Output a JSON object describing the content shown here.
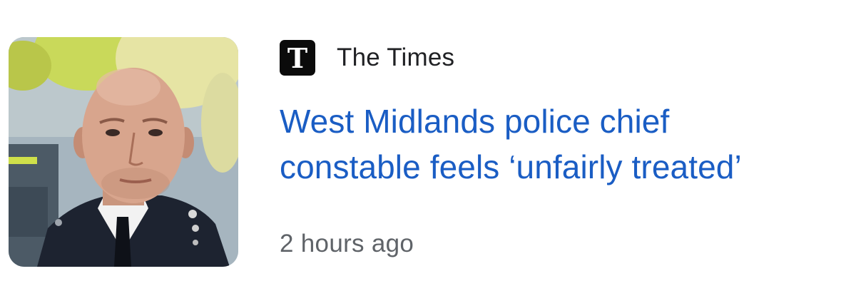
{
  "article": {
    "thumbnail_icon": "police-officer-photo",
    "source": {
      "logo_letter": "T",
      "name": "The Times"
    },
    "headline": {
      "line1": "West Midlands police chief",
      "line2": "constable feels ‘unfairly treated’"
    },
    "timestamp": "2 hours ago",
    "colors": {
      "headline": "#1a5dc4",
      "source_text": "#202124",
      "timestamp": "#5f6368",
      "logo_bg": "#0b0b0b"
    }
  }
}
